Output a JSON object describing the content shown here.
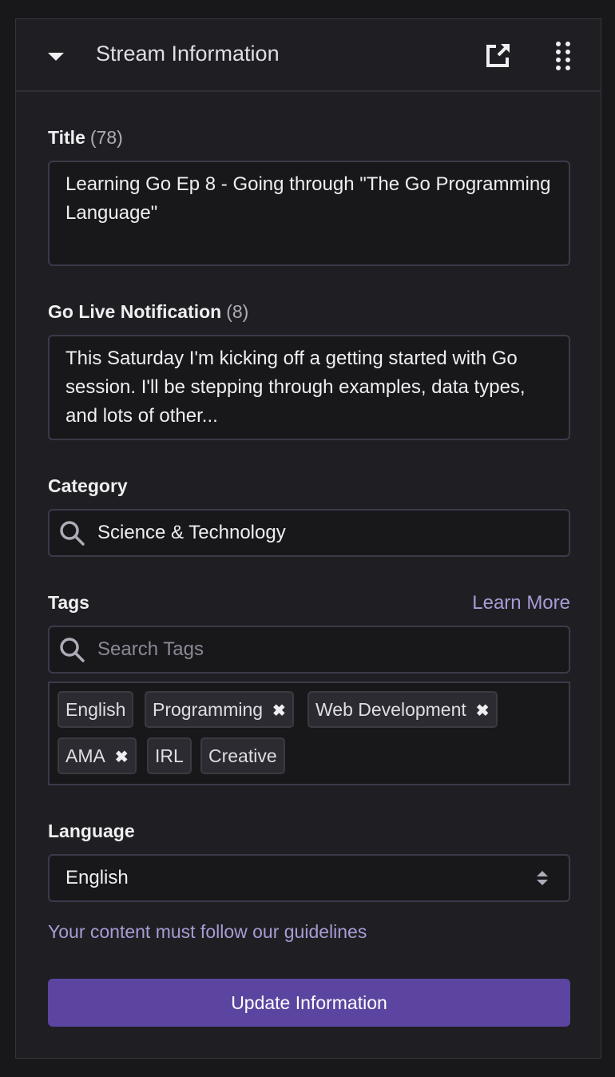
{
  "header": {
    "title": "Stream Information"
  },
  "title_field": {
    "label": "Title",
    "count": "(78)",
    "value": "Learning Go Ep 8 - Going through \"The Go Programming Language\""
  },
  "notification_field": {
    "label": "Go Live Notification",
    "count": "(8)",
    "value": "This Saturday I'm kicking off a getting started with Go session. I'll be stepping through examples, data types, and lots of other..."
  },
  "category_field": {
    "label": "Category",
    "value": "Science & Technology"
  },
  "tags_field": {
    "label": "Tags",
    "learn_more": "Learn More",
    "placeholder": "Search Tags",
    "tags": [
      {
        "label": "English",
        "removable": false
      },
      {
        "label": "Programming",
        "removable": true
      },
      {
        "label": "Web Development",
        "removable": true
      },
      {
        "label": "AMA",
        "removable": true
      },
      {
        "label": "IRL",
        "removable": false
      },
      {
        "label": "Creative",
        "removable": false
      }
    ]
  },
  "language_field": {
    "label": "Language",
    "value": "English"
  },
  "guidelines_link": "Your content must follow our guidelines",
  "update_button": "Update Information",
  "colors": {
    "accent": "#5c45a0",
    "link": "#a99bd6",
    "background": "#1f1f23"
  }
}
